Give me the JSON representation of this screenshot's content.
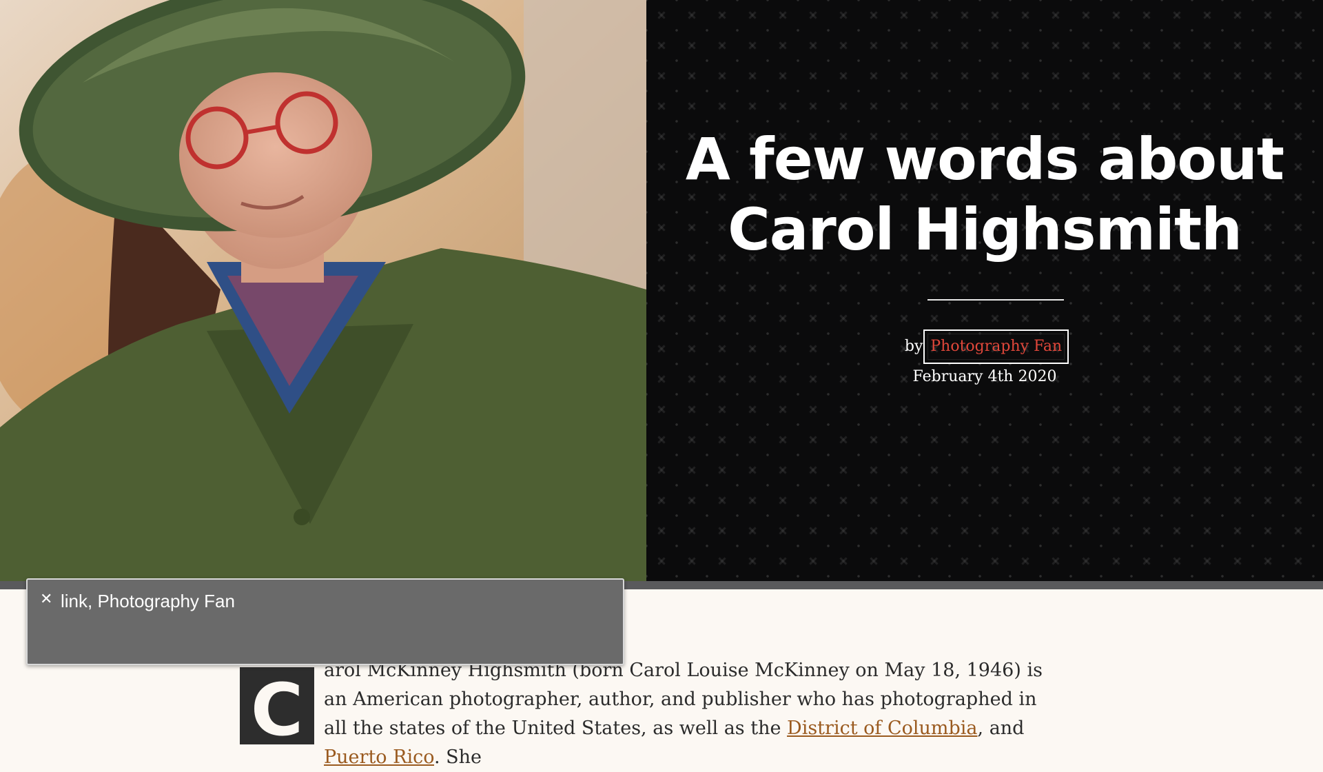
{
  "hero": {
    "title_line1": "A few words about",
    "title_line2": "Carol Highsmith",
    "byline_prefix": "by",
    "author_link": "Photography Fan",
    "date": "February 4th 2020",
    "photo_description_icon": "portrait-photo"
  },
  "article": {
    "drop_cap": "C",
    "text_part1": "arol McKinney Highsmith (born Carol Louise McKinney on May 18, 1946) is an American photographer, author, and publisher who has photographed in all the states of the United States, as well as the ",
    "link1": "District of Columbia",
    "text_part2": ", and ",
    "link2": "Puerto Rico",
    "text_part3": ". She"
  },
  "voiceover_caption": {
    "close_icon": "close-icon",
    "text": "link, Photography Fan"
  },
  "colors": {
    "title_panel_bg": "#0b0b0c",
    "author_link": "#e0473a",
    "body_link": "#9a5a1f",
    "page_bg": "#fcf8f3",
    "caption_bg": "#6a6a6a"
  }
}
